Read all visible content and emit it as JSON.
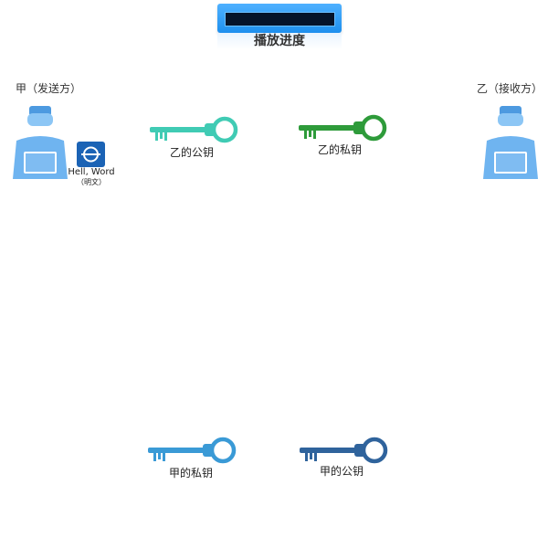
{
  "progress": {
    "title": "播放进度",
    "fraction": 0
  },
  "sender": {
    "label": "甲（发送方）"
  },
  "receiver": {
    "label": "乙（接收方）"
  },
  "message": {
    "text": "Hell, Word",
    "sub": "（明文）"
  },
  "keys": {
    "b_public": {
      "label": "乙的公钥",
      "color": "#40cbb4"
    },
    "b_private": {
      "label": "乙的私钥",
      "color": "#2e9b3a"
    },
    "a_private": {
      "label": "甲的私钥",
      "color": "#3a9ad6"
    },
    "a_public": {
      "label": "甲的公钥",
      "color": "#2f639c"
    }
  },
  "colors": {
    "person": "#6fb4f0",
    "person_dark": "#4d9ae0",
    "message_icon_bg": "#1b63b5"
  }
}
